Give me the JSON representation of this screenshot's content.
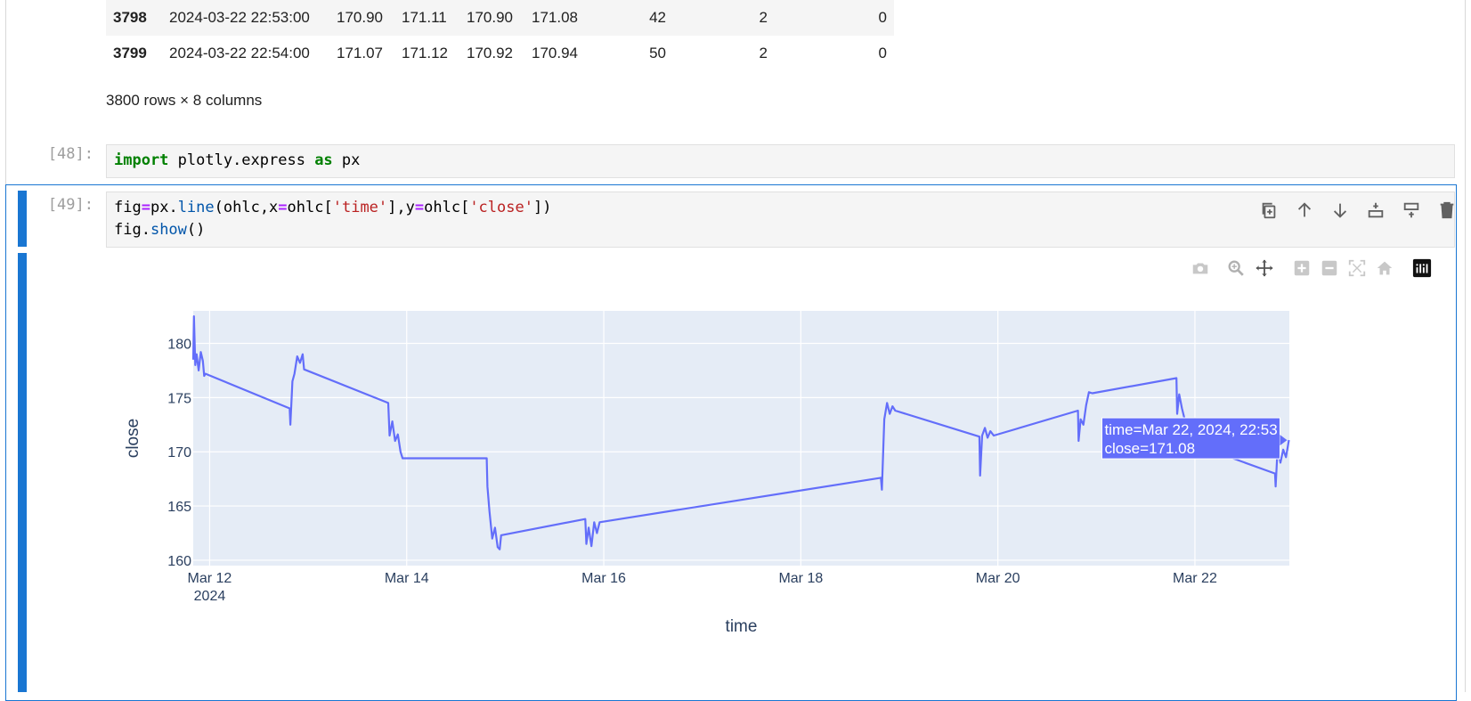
{
  "table": {
    "rows": [
      {
        "index": "3798",
        "time": "2024-03-22 22:53:00",
        "open": "170.90",
        "high": "171.11",
        "low": "170.90",
        "close": "171.08",
        "c5": "42",
        "c6": "2",
        "c7": "0"
      },
      {
        "index": "3799",
        "time": "2024-03-22 22:54:00",
        "open": "171.07",
        "high": "171.12",
        "low": "170.92",
        "close": "170.94",
        "c5": "50",
        "c6": "2",
        "c7": "0"
      }
    ],
    "summary": "3800 rows × 8 columns"
  },
  "cells": {
    "cell48": {
      "prompt": "[48]:",
      "kw_import": "import",
      "module": " plotly.express ",
      "kw_as": "as",
      "alias": " px"
    },
    "cell49": {
      "prompt": "[49]:",
      "line1": {
        "a": "fig",
        "eq": "=",
        "b": "px.",
        "fn": "line",
        "c": "(ohlc,x",
        "eq2": "=",
        "d": "ohlc[",
        "s1": "'time'",
        "e": "],y",
        "eq3": "=",
        "f": "ohlc[",
        "s2": "'close'",
        "g": "])"
      },
      "line2": {
        "a": "fig.",
        "fn": "show",
        "b": "()"
      }
    }
  },
  "toolbar_icons": [
    "duplicate-icon",
    "move-up-icon",
    "move-down-icon",
    "insert-below-icon",
    "insert-above-icon",
    "delete-icon"
  ],
  "modebar_icons": [
    "camera-icon",
    "zoom-icon",
    "pan-icon",
    "zoom-in-icon",
    "zoom-out-icon",
    "autoscale-icon",
    "reset-axes-icon",
    "plotly-logo-icon"
  ],
  "colors": {
    "line": "#636efa",
    "plot_bg": "#e5ecf6",
    "accent": "#1976d2"
  },
  "chart_data": {
    "type": "line",
    "xlabel": "time",
    "ylabel": "close",
    "ylim": [
      159.5,
      183
    ],
    "xlim": [
      "2024-03-11 20:00",
      "2024-03-22 23:00"
    ],
    "x_ticks": [
      "Mar 12",
      "Mar 14",
      "Mar 16",
      "Mar 18",
      "Mar 20",
      "Mar 22"
    ],
    "x_tick_sublabel": "2024",
    "y_ticks": [
      160,
      165,
      170,
      175,
      180
    ],
    "grid": true,
    "series": [
      {
        "x": [
          "2024-03-11 20:00",
          "2024-03-11 20:10",
          "2024-03-11 20:30",
          "2024-03-11 20:50",
          "2024-03-11 21:20",
          "2024-03-11 21:50",
          "2024-03-11 22:20",
          "2024-03-11 22:40",
          "2024-03-11 23:00",
          "2024-03-12 19:30",
          "2024-03-12 19:40",
          "2024-03-12 20:10",
          "2024-03-12 20:40",
          "2024-03-12 21:20",
          "2024-03-12 22:00",
          "2024-03-12 22:40",
          "2024-03-12 23:00",
          "2024-03-13 19:30",
          "2024-03-13 19:50",
          "2024-03-13 20:30",
          "2024-03-13 21:10",
          "2024-03-13 21:50",
          "2024-03-13 22:30",
          "2024-03-13 23:00",
          "2024-03-14 19:30",
          "2024-03-14 19:40",
          "2024-03-14 20:10",
          "2024-03-14 20:50",
          "2024-03-14 21:30",
          "2024-03-14 22:10",
          "2024-03-14 22:40",
          "2024-03-14 23:00",
          "2024-03-15 19:30",
          "2024-03-15 19:45",
          "2024-03-15 20:20",
          "2024-03-15 21:00",
          "2024-03-15 21:40",
          "2024-03-15 22:20",
          "2024-03-15 23:00",
          "2024-03-18 19:30",
          "2024-03-18 19:45",
          "2024-03-18 20:20",
          "2024-03-18 21:00",
          "2024-03-18 21:40",
          "2024-03-18 22:20",
          "2024-03-18 23:00",
          "2024-03-19 19:30",
          "2024-03-19 19:40",
          "2024-03-19 20:10",
          "2024-03-19 20:50",
          "2024-03-19 21:30",
          "2024-03-19 22:10",
          "2024-03-19 23:00",
          "2024-03-20 19:30",
          "2024-03-20 19:40",
          "2024-03-20 20:10",
          "2024-03-20 20:50",
          "2024-03-20 21:30",
          "2024-03-20 22:10",
          "2024-03-20 23:00",
          "2024-03-21 19:30",
          "2024-03-21 19:40",
          "2024-03-21 20:10",
          "2024-03-21 20:50",
          "2024-03-21 21:30",
          "2024-03-21 22:10",
          "2024-03-21 22:40",
          "2024-03-21 23:00",
          "2024-03-22 19:30",
          "2024-03-22 19:40",
          "2024-03-22 20:10",
          "2024-03-22 20:50",
          "2024-03-22 21:30",
          "2024-03-22 22:10",
          "2024-03-22 22:53"
        ],
        "y": [
          178.5,
          182.5,
          178.0,
          179.0,
          177.5,
          179.2,
          178.4,
          177.0,
          177.2,
          174.0,
          172.5,
          176.5,
          177.2,
          178.8,
          178.2,
          179.0,
          177.6,
          174.5,
          171.5,
          172.8,
          171.0,
          171.6,
          170.0,
          169.4,
          169.4,
          166.8,
          164.5,
          162.0,
          163.0,
          161.2,
          161.0,
          162.3,
          163.8,
          161.5,
          163.0,
          161.3,
          163.5,
          162.5,
          163.5,
          167.6,
          166.5,
          173.0,
          174.5,
          173.5,
          174.2,
          173.8,
          171.4,
          167.8,
          171.5,
          172.2,
          171.3,
          171.9,
          171.5,
          173.8,
          171.0,
          173.0,
          172.5,
          174.3,
          175.5,
          175.4,
          176.8,
          173.5,
          175.3,
          174.0,
          173.0,
          172.2,
          171.5,
          170.8,
          168.0,
          166.8,
          170.5,
          169.0,
          170.2,
          169.5,
          171.08
        ]
      }
    ],
    "tooltip": {
      "line1": "time=Mar 22, 2024, 22:53",
      "line2": "close=171.08"
    }
  }
}
